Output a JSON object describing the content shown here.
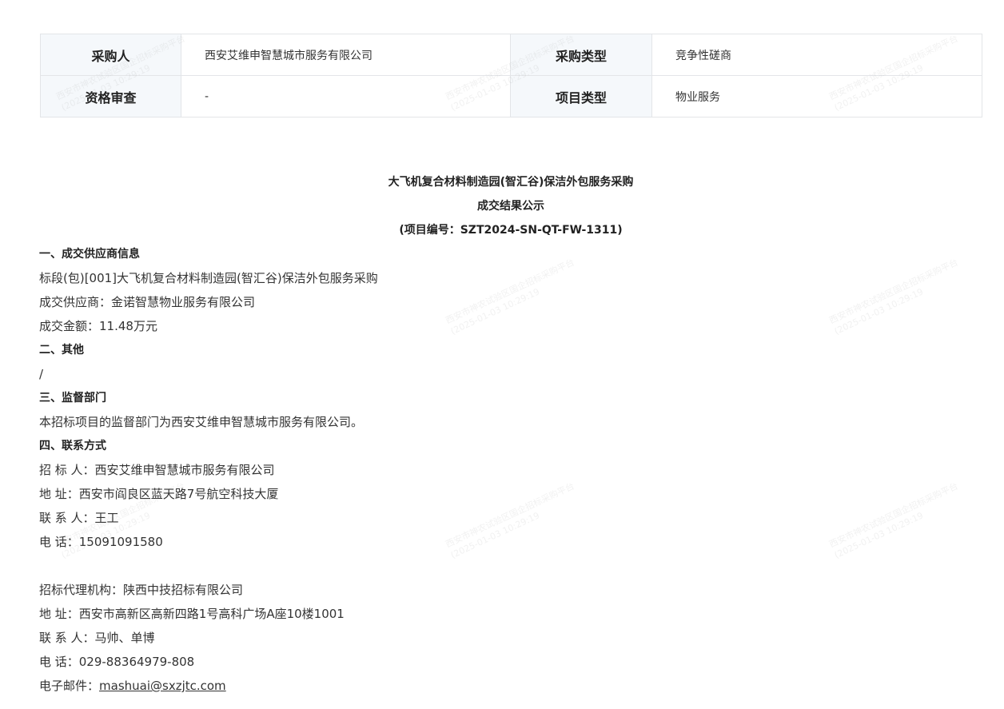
{
  "info_table": {
    "rows": [
      [
        {
          "label": "采购人",
          "value": "西安艾维申智慧城市服务有限公司"
        },
        {
          "label": "采购类型",
          "value": "竞争性磋商"
        }
      ],
      [
        {
          "label": "资格审查",
          "value": "-"
        },
        {
          "label": "项目类型",
          "value": "物业服务"
        }
      ]
    ]
  },
  "notice": {
    "title": "大飞机复合材料制造园(智汇谷)保洁外包服务采购",
    "subtitle": "成交结果公示",
    "project_no": "(项目编号：SZT2024-SN-QT-FW-1311)",
    "sections": [
      {
        "heading": "一、成交供应商信息",
        "lines": [
          "标段(包)[001]大飞机复合材料制造园(智汇谷)保洁外包服务采购",
          "成交供应商：金诺智慧物业服务有限公司",
          "成交金额：11.48万元"
        ]
      },
      {
        "heading": "二、其他",
        "lines": [
          "/"
        ]
      },
      {
        "heading": "三、监督部门",
        "lines": [
          "本招标项目的监督部门为西安艾维申智慧城市服务有限公司。"
        ]
      },
      {
        "heading": "四、联系方式",
        "lines": [
          "招 标 人：西安艾维申智慧城市服务有限公司",
          "地 址：西安市阎良区蓝天路7号航空科技大厦",
          "联 系 人：王工",
          "电 话：15091091580"
        ]
      }
    ],
    "agency": {
      "lines": [
        "招标代理机构：陕西中技招标有限公司",
        "地 址：西安市高新区高新四路1号高科广场A座10楼1001",
        "联 系 人：马帅、单博",
        "电 话：029-88364979-808"
      ],
      "email_label": "电子邮件：",
      "email": "mashuai@sxzjtc.com"
    }
  },
  "watermark": {
    "line1": "西安市神农试验区国企招标采购平台",
    "line2": "(2025-01-03 10:29:19"
  }
}
